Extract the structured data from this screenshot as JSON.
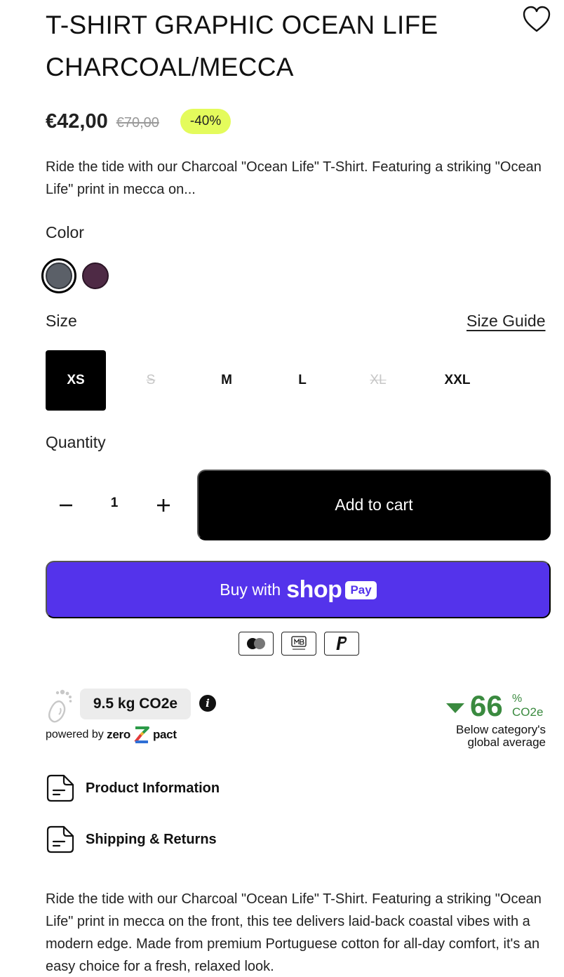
{
  "product": {
    "title": "T-SHIRT GRAPHIC OCEAN LIFE CHARCOAL/MECCA",
    "price": "€42,00",
    "old_price": "€70,00",
    "discount_badge": "-40%",
    "short_description": "Ride the tide with our Charcoal \"Ocean Life\" T-Shirt. Featuring a striking \"Ocean Life\" print in mecca on...",
    "long_description": "Ride the tide with our Charcoal \"Ocean Life\" T-Shirt. Featuring a striking \"Ocean Life\" print in mecca on the front, this tee delivers laid-back coastal vibes with a modern edge. Made from premium Portuguese cotton for all-day comfort, it's an easy choice for a fresh, relaxed look."
  },
  "color": {
    "label": "Color",
    "swatches": [
      {
        "name": "Charcoal",
        "hex": "#5b6068",
        "selected": true
      },
      {
        "name": "Mecca",
        "hex": "#4e2a45",
        "selected": false
      }
    ]
  },
  "size": {
    "label": "Size",
    "guide_label": "Size Guide",
    "options": [
      {
        "label": "XS",
        "state": "selected"
      },
      {
        "label": "S",
        "state": "disabled"
      },
      {
        "label": "M",
        "state": "available"
      },
      {
        "label": "L",
        "state": "available"
      },
      {
        "label": "XL",
        "state": "disabled"
      },
      {
        "label": "XXL",
        "state": "available"
      }
    ]
  },
  "quantity": {
    "label": "Quantity",
    "value": "1"
  },
  "actions": {
    "add_to_cart": "Add to cart",
    "buy_with": "Buy with",
    "shop_brand": "shop",
    "pay_badge": "Pay"
  },
  "payment_icons": [
    "mastercard-icon",
    "multibanco-icon",
    "paypal-icon"
  ],
  "footprint": {
    "co2_value": "9.5 kg CO2e",
    "powered_by": "powered by",
    "brand_left": "zero",
    "brand_right": "pact",
    "reduction_value": "66",
    "reduction_unit_pct": "%",
    "reduction_unit": "CO2e",
    "reduction_note": "Below category's global average"
  },
  "accordions": [
    {
      "label": "Product Information"
    },
    {
      "label": "Shipping & Returns"
    }
  ],
  "colors": {
    "accent_badge": "#e4fb5c",
    "shop_pay": "#5433eb",
    "eco_green": "#3a8a3f"
  }
}
